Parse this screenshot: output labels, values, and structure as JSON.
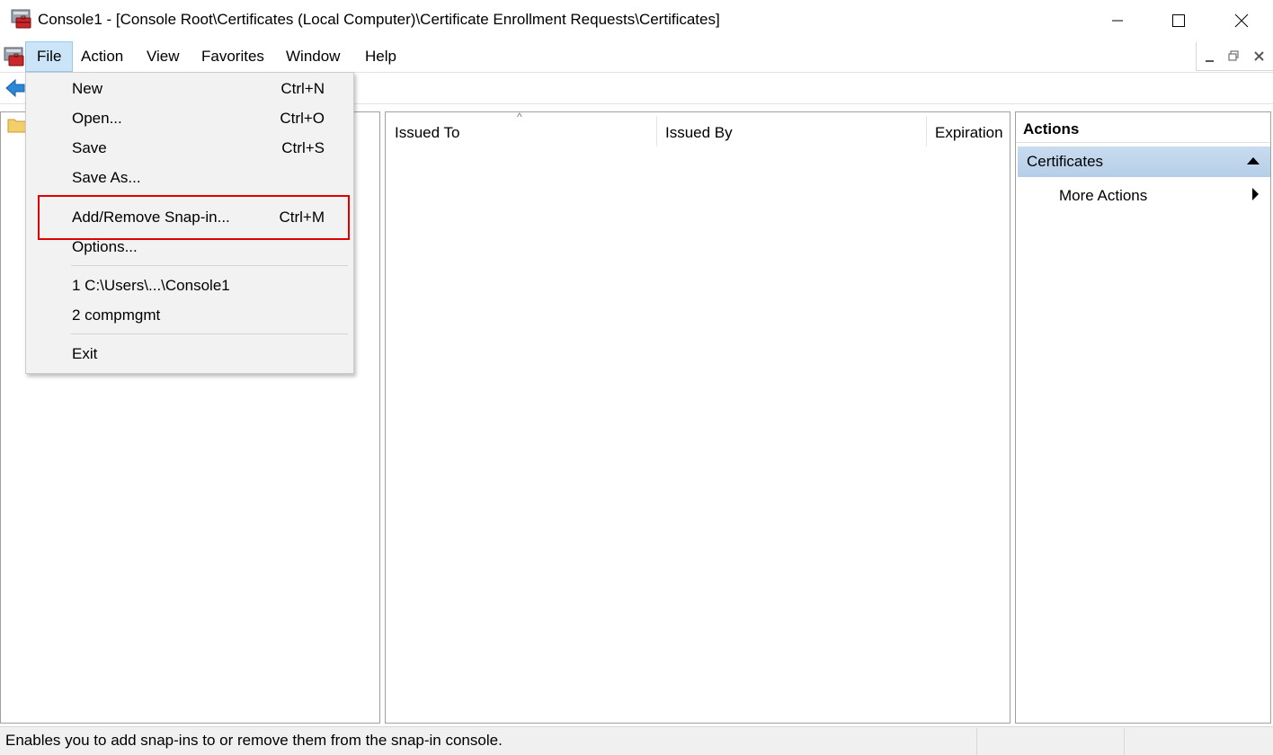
{
  "window": {
    "title": "Console1 - [Console Root\\Certificates (Local Computer)\\Certificate Enrollment Requests\\Certificates]"
  },
  "menubar": {
    "items": [
      {
        "label": "File"
      },
      {
        "label": "Action"
      },
      {
        "label": "View"
      },
      {
        "label": "Favorites"
      },
      {
        "label": "Window"
      },
      {
        "label": "Help"
      }
    ]
  },
  "file_menu": {
    "items": [
      {
        "label": "New",
        "shortcut": "Ctrl+N"
      },
      {
        "label": "Open...",
        "shortcut": "Ctrl+O"
      },
      {
        "label": "Save",
        "shortcut": "Ctrl+S"
      },
      {
        "label": "Save As...",
        "shortcut": ""
      },
      {
        "label": "Add/Remove Snap-in...",
        "shortcut": "Ctrl+M"
      },
      {
        "label": "Options...",
        "shortcut": ""
      },
      {
        "label": "1 C:\\Users\\...\\Console1",
        "shortcut": ""
      },
      {
        "label": "2 compmgmt",
        "shortcut": ""
      },
      {
        "label": "Exit",
        "shortcut": ""
      }
    ]
  },
  "list": {
    "columns": [
      {
        "label": "Issued To"
      },
      {
        "label": "Issued By"
      },
      {
        "label": "Expiration"
      }
    ],
    "sort_indicator": "^"
  },
  "actions": {
    "header": "Actions",
    "section_title": "Certificates",
    "more_actions": "More Actions"
  },
  "status": {
    "text": "Enables you to add snap-ins to or remove them from the snap-in console."
  },
  "colors": {
    "highlight": "#e00000",
    "menu_selected": "#cce4f7",
    "section_bg": "#b5cee8",
    "back_arrow": "#2b87d8"
  },
  "icons": [
    "app-icon",
    "child-window-icon",
    "back-arrow-icon",
    "folder-icon",
    "minimize-icon",
    "maximize-icon",
    "close-icon"
  ]
}
